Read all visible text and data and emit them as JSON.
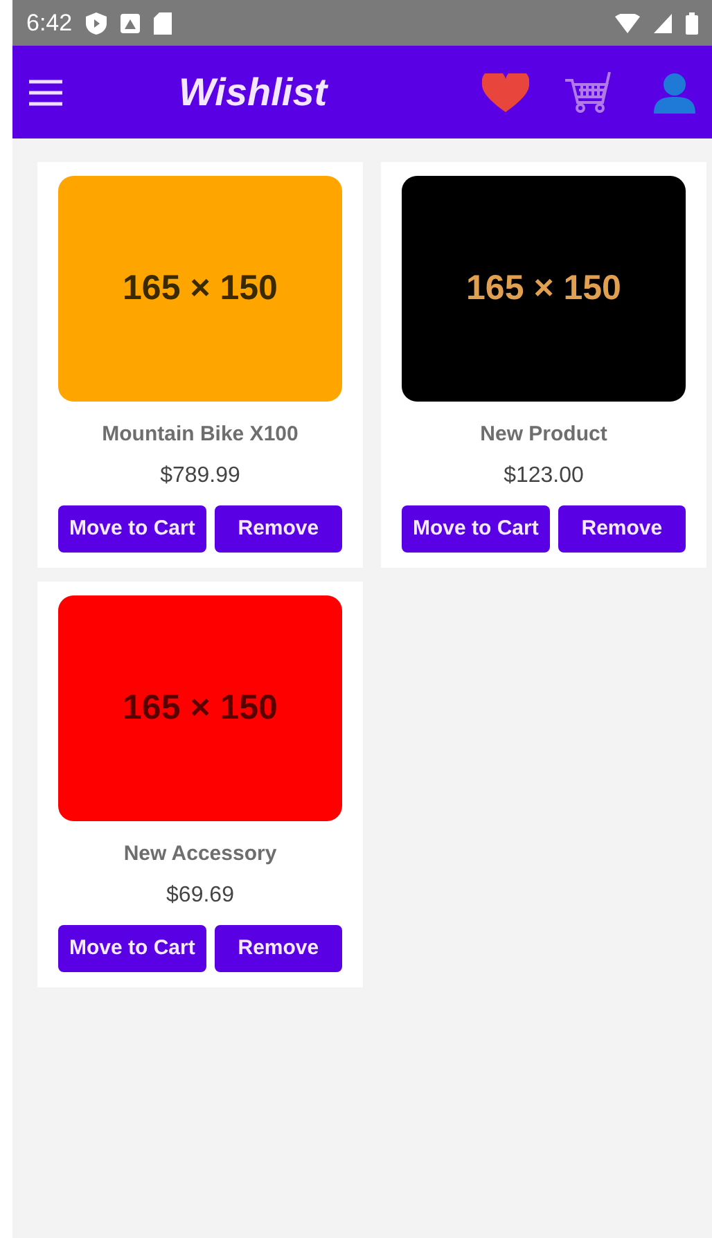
{
  "status_bar": {
    "time": "6:42"
  },
  "app_bar": {
    "title": "Wishlist"
  },
  "items": [
    {
      "name": "Mountain Bike X100",
      "price": "$789.99",
      "color": "#ffa500",
      "image_label": {
        "text": "165 × 150",
        "color": "#3a2a00"
      },
      "buttons": [
        "Move to Cart",
        "Remove"
      ]
    },
    {
      "name": "New Product",
      "price": "$123.00",
      "color": "#000000",
      "image_label": {
        "text": "165 × 150",
        "color": "#e0a050"
      },
      "buttons": [
        "Move to Cart",
        "Remove"
      ]
    },
    {
      "name": "New Accessory",
      "price": "$69.69",
      "color": "#ff0000",
      "image_label": {
        "text": "165 × 150",
        "color": "#5a0000"
      },
      "buttons": [
        "Move to Cart",
        "Remove"
      ]
    }
  ]
}
